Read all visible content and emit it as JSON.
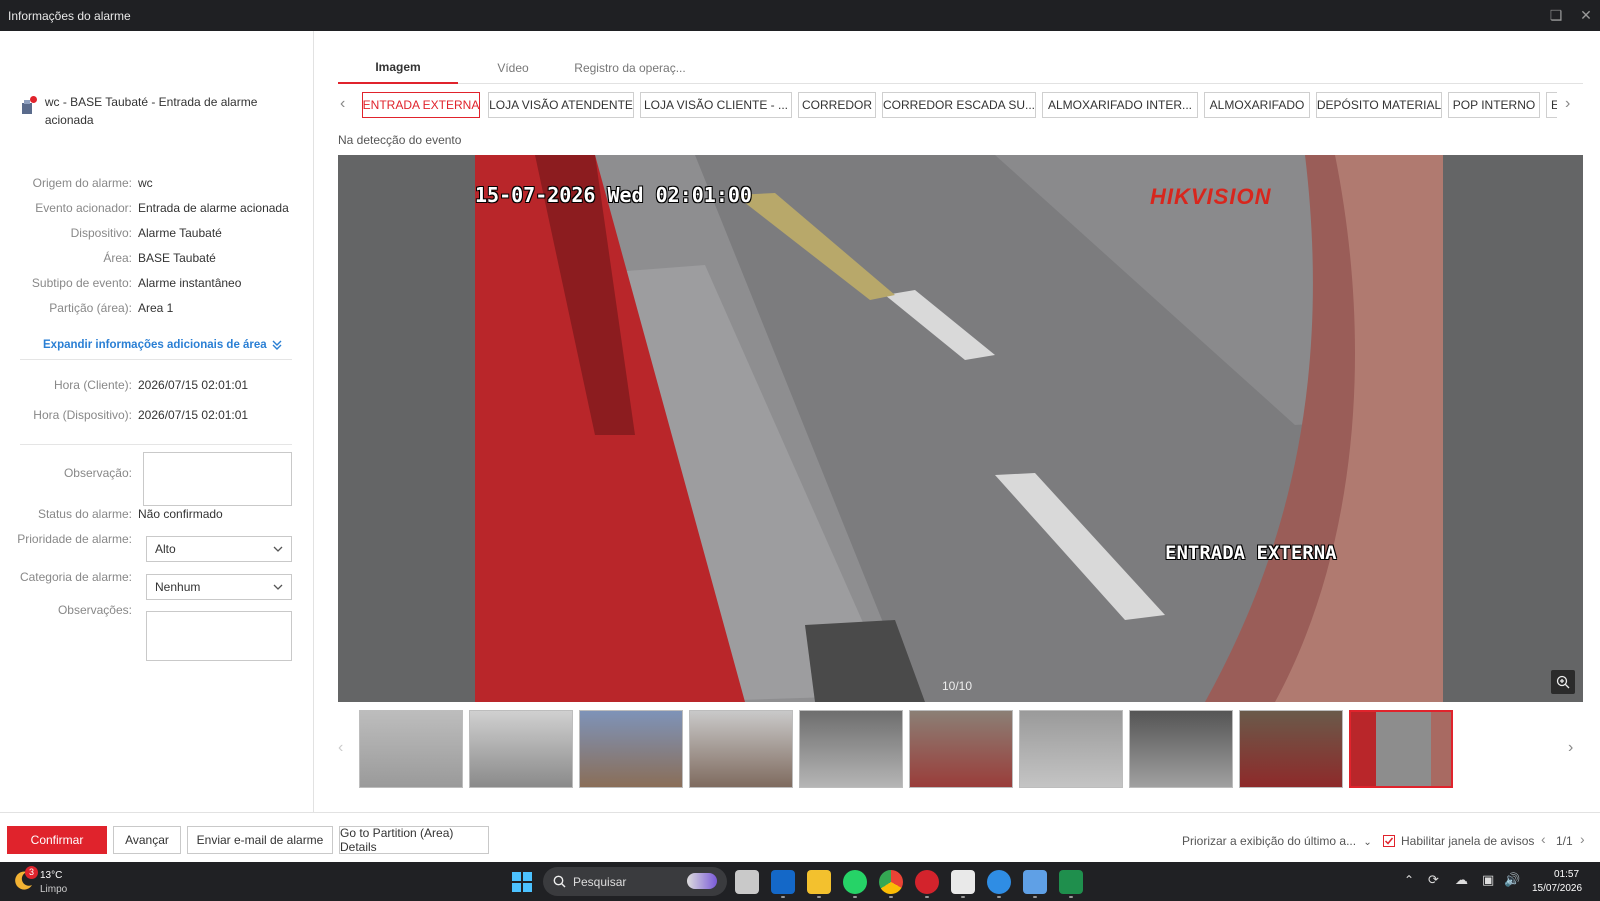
{
  "window": {
    "title": "Informações do alarme"
  },
  "alarm": {
    "title": "wc - BASE Taubaté - Entrada de alarme acionada",
    "fields": [
      {
        "label": "Origem do alarme:",
        "value": "wc"
      },
      {
        "label": "Evento acionador:",
        "value": "Entrada de alarme acionada"
      },
      {
        "label": "Dispositivo:",
        "value": "Alarme Taubaté"
      },
      {
        "label": "Área:",
        "value": "BASE Taubaté"
      },
      {
        "label": "Subtipo de evento:",
        "value": "Alarme instantâneo"
      },
      {
        "label": "Partição (área):",
        "value": "Area 1"
      }
    ],
    "expand_label": "Expandir informações adicionais de área",
    "time_client_label": "Hora (Cliente):",
    "time_client": "2026/07/15 02:01:01",
    "time_device_label": "Hora (Dispositivo):",
    "time_device": "2026/07/15 02:01:01",
    "observation_label": "Observação:",
    "status_label": "Status do alarme:",
    "status_value": "Não confirmado",
    "priority_label": "Prioridade de alarme:",
    "priority_value": "Alto",
    "category_label": "Categoria de alarme:",
    "category_value": "Nenhum",
    "notes_label": "Observações:"
  },
  "tabs": [
    "Imagem",
    "Vídeo",
    "Registro da operaç..."
  ],
  "cameras": [
    "ENTRADA EXTERNA",
    "LOJA VISÃO ATENDENTE",
    "LOJA VISÃO CLIENTE - ...",
    "CORREDOR",
    "CORREDOR ESCADA SU...",
    "ALMOXARIFADO INTER...",
    "ALMOXARIFADO",
    "DEPÓSITO MATERIAL",
    "POP INTERNO",
    "E"
  ],
  "viewer": {
    "caption": "Na detecção do evento",
    "timestamp": "15-07-2026 Wed 02:01:00",
    "brand": "HIKVISION",
    "camera_name": "ENTRADA EXTERNA",
    "counter": "10/10",
    "selected_thumbnail": 10
  },
  "footer": {
    "confirm": "Confirmar",
    "advance": "Avançar",
    "send_email": "Enviar e-mail de alarme",
    "partition_details": "Go to Partition (Area) Details",
    "prioritize": "Priorizar a exibição do último a...",
    "enable_popup": "Habilitar janela de avisos",
    "enable_popup_checked": true,
    "page": "1/1"
  },
  "taskbar": {
    "weather_temp": "13°C",
    "weather_desc": "Limpo",
    "weather_badge": "3",
    "search_placeholder": "Pesquisar",
    "time": "01:57",
    "date": "15/07/2026"
  },
  "colors": {
    "accent": "#e0232c",
    "link": "#2a7fd4",
    "titlebar": "#1f2023"
  }
}
